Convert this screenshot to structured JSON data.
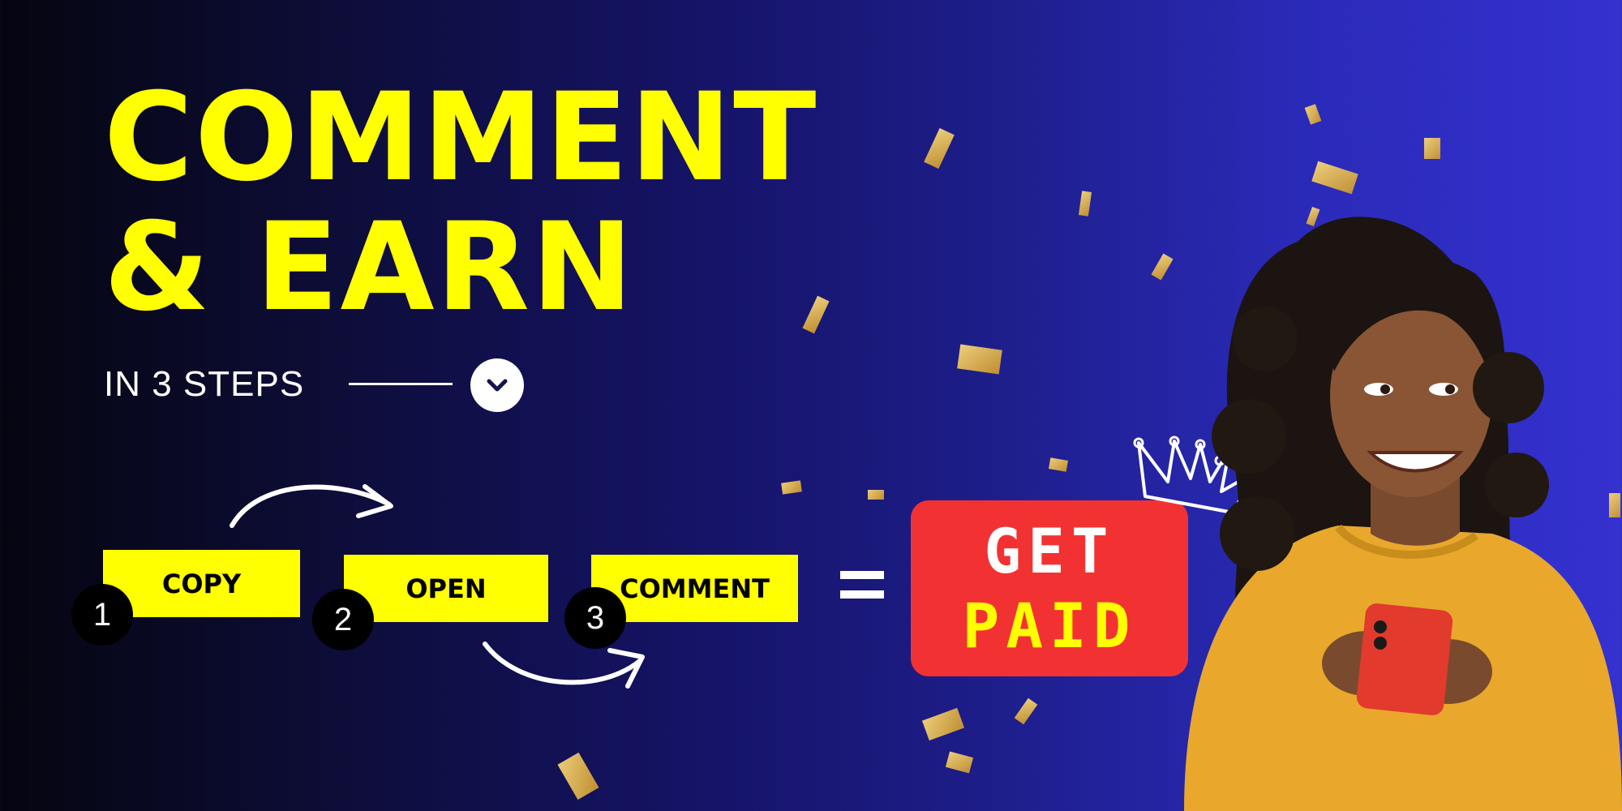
{
  "headline": {
    "line1": "COMMENT",
    "line2": "& EARN"
  },
  "subtitle": "IN 3 STEPS",
  "steps": [
    {
      "number": "1",
      "label": "COPY"
    },
    {
      "number": "2",
      "label": "OPEN"
    },
    {
      "number": "3",
      "label": "COMMENT"
    }
  ],
  "equals_sign": "=",
  "cta": {
    "line1": "GET",
    "line2": "PAID"
  },
  "icons": [
    "chevron-down-icon",
    "arrow-icon",
    "crown-icon"
  ],
  "colors": {
    "accent": "#ffff00",
    "cta": "#f23232",
    "sweater": "#e9a82c"
  }
}
